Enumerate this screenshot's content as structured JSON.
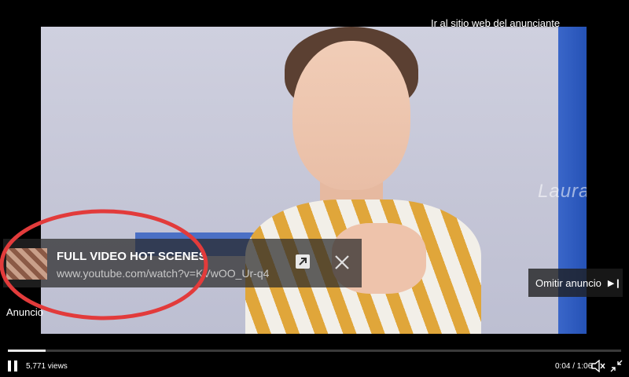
{
  "player": {
    "advertiser_link": "Ir al sitio web del anunciante",
    "watermark": "LauraG.",
    "ad_label": "Anuncio",
    "skip_label": "Omitir anuncio",
    "views": "5,771 views",
    "time": "0:04 / 1:06",
    "progress_fraction": 0.061
  },
  "ad_banner": {
    "title": "FULL VIDEO HOT SCENES",
    "url": "www.youtube.com/watch?v=KVwOO_Ur-q4"
  },
  "colors": {
    "annotation": "#e23b3b",
    "banner_bg": "#282828",
    "accent_blue": "#2d5bc0"
  }
}
